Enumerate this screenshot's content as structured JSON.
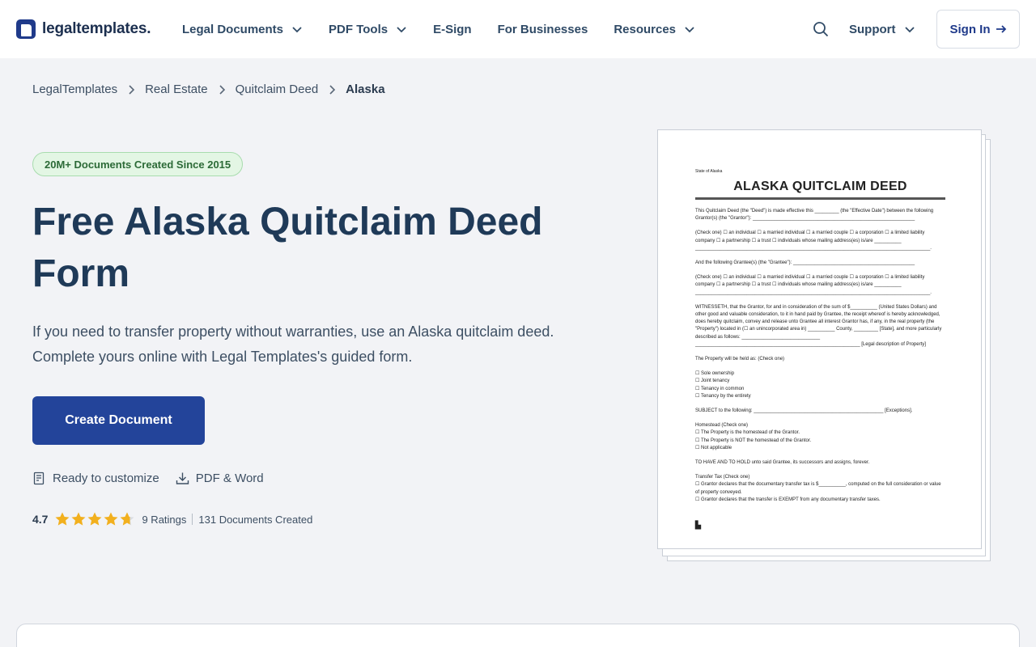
{
  "header": {
    "logo_text": "legaltemplates.",
    "nav": [
      {
        "label": "Legal Documents",
        "has_dropdown": true
      },
      {
        "label": "PDF Tools",
        "has_dropdown": true
      },
      {
        "label": "E-Sign",
        "has_dropdown": false
      },
      {
        "label": "For Businesses",
        "has_dropdown": false
      },
      {
        "label": "Resources",
        "has_dropdown": true
      }
    ],
    "support_label": "Support",
    "signin_label": "Sign In"
  },
  "breadcrumb": [
    "LegalTemplates",
    "Real Estate",
    "Quitclaim Deed",
    "Alaska"
  ],
  "hero": {
    "badge": "20M+ Documents Created Since 2015",
    "title": "Free Alaska Quitclaim Deed Form",
    "subtitle": "If you need to transfer property without warranties, use an Alaska quitclaim deed. Complete yours online with Legal Templates's guided form.",
    "cta_label": "Create Document",
    "features": [
      "Ready to customize",
      "PDF & Word"
    ],
    "rating": {
      "score": "4.7",
      "stars": 4.7,
      "ratings_text": "9 Ratings",
      "documents_text": "131 Documents Created"
    }
  },
  "preview": {
    "state_label": "State of Alaska",
    "title": "ALASKA QUITCLAIM DEED",
    "paragraphs": [
      "This Quitclaim Deed (the \"Deed\") is made effective this _________ (the \"Effective Date\") between the following Grantor(s) (the \"Grantor\"): ____________________________________________________________",
      "(Check one) ☐ an individual ☐ a married individual ☐ a married couple ☐ a corporation ☐ a limited liability company ☐ a partnership ☐ a trust ☐ individuals whose mailing address(es) is/are __________ _______________________________________________________________________________________.",
      "And the following Grantee(s) (the \"Grantee\"): _____________________________________________",
      "(Check one) ☐ an individual ☐ a married individual ☐ a married couple ☐ a corporation ☐ a limited liability company ☐ a partnership ☐ a trust ☐ individuals whose mailing address(es) is/are __________ _______________________________________________________________________________________.",
      "WITNESSETH, that the Grantor, for and in consideration of the sum of $__________ (United States Dollars) and other good and valuable consideration, to it in hand paid by Grantee, the receipt whereof is hereby acknowledged, does hereby quitclaim, convey and release unto Grantee all interest Grantor has, if any, in the real property (the \"Property\") located in (☐ an unincorporated area in) __________ County, _________ [State], and more particularly described as follows: _____________________________ _____________________________________________________________ [Legal description of Property]",
      "The Property will be held as: (Check one)",
      "☐ Sole ownership\n☐ Joint tenancy\n☐ Tenancy in common\n☐ Tenancy by the entirety",
      "SUBJECT to the following: ________________________________________________ [Exceptions].",
      "Homestead (Check one)\n☐ The Property is the homestead of the Grantor.\n☐ The Property is NOT the homestead of the Grantor.\n☐ Not applicable",
      "TO HAVE AND TO HOLD unto said Grantee, its successors and assigns, forever.",
      "Transfer Tax (Check one)\n☐ Grantor declares that the documentary transfer tax is $__________, computed on the full consideration or value of property conveyed.\n☐ Grantor declares that the transfer is EXEMPT from any documentary transfer taxes."
    ]
  },
  "colors": {
    "primary": "#23449a",
    "heading": "#1f3a58",
    "badge_bg": "#e3f6e4",
    "badge_text": "#2c6a37",
    "star": "#f2b01e",
    "page_bg": "#f2f3f6"
  }
}
